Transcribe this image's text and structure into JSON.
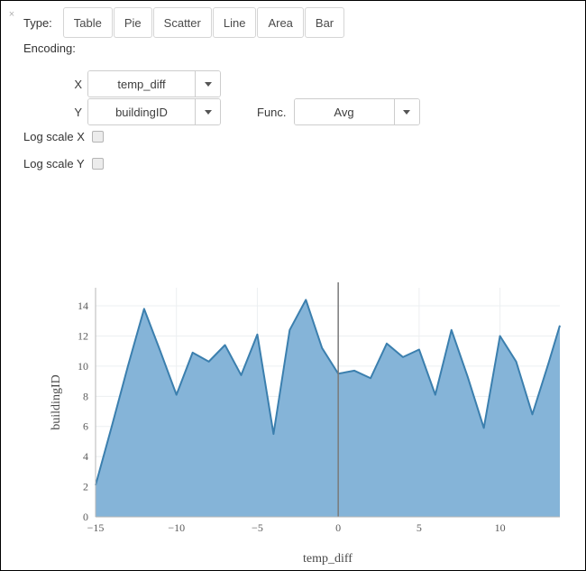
{
  "panel": {
    "close_icon": "×",
    "type_label": "Type:",
    "encoding_label": "Encoding:"
  },
  "type_buttons": [
    {
      "label": "Table",
      "name": "type-button-table"
    },
    {
      "label": "Pie",
      "name": "type-button-pie"
    },
    {
      "label": "Scatter",
      "name": "type-button-scatter"
    },
    {
      "label": "Line",
      "name": "type-button-line"
    },
    {
      "label": "Area",
      "name": "type-button-area"
    },
    {
      "label": "Bar",
      "name": "type-button-bar"
    }
  ],
  "encoding": {
    "x_letter": "X",
    "x_value": "temp_diff",
    "y_letter": "Y",
    "y_value": "buildingID",
    "func_label": "Func.",
    "func_value": "Avg"
  },
  "options": {
    "log_scale_x_label": "Log scale X",
    "log_scale_y_label": "Log scale Y",
    "log_scale_x_checked": false,
    "log_scale_y_checked": false
  },
  "colors": {
    "area_fill": "#85b4d8",
    "line_stroke": "#3b7fae",
    "grid": "#eceff1",
    "axis": "#b7b7b7",
    "rule": "#7a7a7a",
    "tick_text": "#5b5b5b",
    "panel_border": "#000000"
  },
  "chart_data": {
    "type": "area",
    "title": "",
    "xlabel": "temp_diff",
    "ylabel": "buildingID",
    "xlim": [
      -15,
      13.7
    ],
    "ylim": [
      0,
      15.2
    ],
    "xticks": [
      -15,
      -10,
      -5,
      0,
      5,
      10
    ],
    "yticks": [
      0,
      2,
      4,
      6,
      8,
      10,
      12,
      14
    ],
    "xtick_labels": [
      "−15",
      "−10",
      "−5",
      "0",
      "5",
      "10"
    ],
    "ytick_labels": [
      "0",
      "2",
      "4",
      "6",
      "8",
      "10",
      "12",
      "14"
    ],
    "grid": true,
    "legend": "none",
    "rule_x": 0,
    "series": [
      {
        "name": "Avg buildingID",
        "x": [
          -15,
          -14,
          -13,
          -12,
          -11,
          -10,
          -9,
          -8,
          -7,
          -6,
          -5,
          -4,
          -3,
          -2,
          -1,
          0,
          1,
          2,
          3,
          4,
          5,
          6,
          7,
          8,
          9,
          10,
          11,
          12,
          13,
          13.7
        ],
        "values": [
          2.1,
          6.0,
          10.0,
          13.8,
          11.0,
          8.1,
          10.9,
          10.3,
          11.4,
          9.4,
          12.1,
          5.5,
          12.4,
          14.4,
          11.2,
          9.5,
          9.7,
          9.2,
          11.5,
          10.6,
          11.1,
          8.1,
          12.4,
          9.3,
          5.9,
          12.0,
          10.3,
          6.8,
          10.2,
          12.7
        ]
      }
    ]
  }
}
